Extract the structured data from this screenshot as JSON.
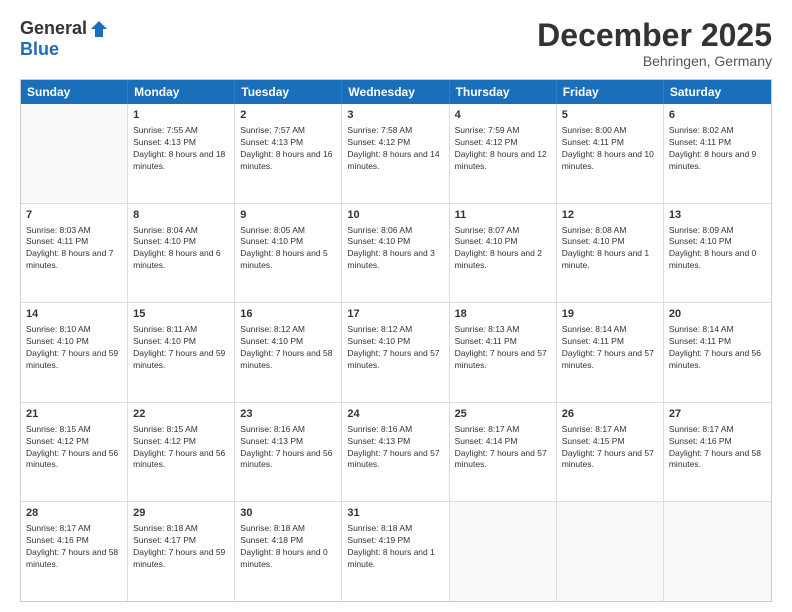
{
  "logo": {
    "general": "General",
    "blue": "Blue"
  },
  "title": "December 2025",
  "subtitle": "Behringen, Germany",
  "header_days": [
    "Sunday",
    "Monday",
    "Tuesday",
    "Wednesday",
    "Thursday",
    "Friday",
    "Saturday"
  ],
  "weeks": [
    [
      {
        "day": "",
        "empty": true
      },
      {
        "day": "1",
        "sunrise": "Sunrise: 7:55 AM",
        "sunset": "Sunset: 4:13 PM",
        "daylight": "Daylight: 8 hours and 18 minutes."
      },
      {
        "day": "2",
        "sunrise": "Sunrise: 7:57 AM",
        "sunset": "Sunset: 4:13 PM",
        "daylight": "Daylight: 8 hours and 16 minutes."
      },
      {
        "day": "3",
        "sunrise": "Sunrise: 7:58 AM",
        "sunset": "Sunset: 4:12 PM",
        "daylight": "Daylight: 8 hours and 14 minutes."
      },
      {
        "day": "4",
        "sunrise": "Sunrise: 7:59 AM",
        "sunset": "Sunset: 4:12 PM",
        "daylight": "Daylight: 8 hours and 12 minutes."
      },
      {
        "day": "5",
        "sunrise": "Sunrise: 8:00 AM",
        "sunset": "Sunset: 4:11 PM",
        "daylight": "Daylight: 8 hours and 10 minutes."
      },
      {
        "day": "6",
        "sunrise": "Sunrise: 8:02 AM",
        "sunset": "Sunset: 4:11 PM",
        "daylight": "Daylight: 8 hours and 9 minutes."
      }
    ],
    [
      {
        "day": "7",
        "sunrise": "Sunrise: 8:03 AM",
        "sunset": "Sunset: 4:11 PM",
        "daylight": "Daylight: 8 hours and 7 minutes."
      },
      {
        "day": "8",
        "sunrise": "Sunrise: 8:04 AM",
        "sunset": "Sunset: 4:10 PM",
        "daylight": "Daylight: 8 hours and 6 minutes."
      },
      {
        "day": "9",
        "sunrise": "Sunrise: 8:05 AM",
        "sunset": "Sunset: 4:10 PM",
        "daylight": "Daylight: 8 hours and 5 minutes."
      },
      {
        "day": "10",
        "sunrise": "Sunrise: 8:06 AM",
        "sunset": "Sunset: 4:10 PM",
        "daylight": "Daylight: 8 hours and 3 minutes."
      },
      {
        "day": "11",
        "sunrise": "Sunrise: 8:07 AM",
        "sunset": "Sunset: 4:10 PM",
        "daylight": "Daylight: 8 hours and 2 minutes."
      },
      {
        "day": "12",
        "sunrise": "Sunrise: 8:08 AM",
        "sunset": "Sunset: 4:10 PM",
        "daylight": "Daylight: 8 hours and 1 minute."
      },
      {
        "day": "13",
        "sunrise": "Sunrise: 8:09 AM",
        "sunset": "Sunset: 4:10 PM",
        "daylight": "Daylight: 8 hours and 0 minutes."
      }
    ],
    [
      {
        "day": "14",
        "sunrise": "Sunrise: 8:10 AM",
        "sunset": "Sunset: 4:10 PM",
        "daylight": "Daylight: 7 hours and 59 minutes."
      },
      {
        "day": "15",
        "sunrise": "Sunrise: 8:11 AM",
        "sunset": "Sunset: 4:10 PM",
        "daylight": "Daylight: 7 hours and 59 minutes."
      },
      {
        "day": "16",
        "sunrise": "Sunrise: 8:12 AM",
        "sunset": "Sunset: 4:10 PM",
        "daylight": "Daylight: 7 hours and 58 minutes."
      },
      {
        "day": "17",
        "sunrise": "Sunrise: 8:12 AM",
        "sunset": "Sunset: 4:10 PM",
        "daylight": "Daylight: 7 hours and 57 minutes."
      },
      {
        "day": "18",
        "sunrise": "Sunrise: 8:13 AM",
        "sunset": "Sunset: 4:11 PM",
        "daylight": "Daylight: 7 hours and 57 minutes."
      },
      {
        "day": "19",
        "sunrise": "Sunrise: 8:14 AM",
        "sunset": "Sunset: 4:11 PM",
        "daylight": "Daylight: 7 hours and 57 minutes."
      },
      {
        "day": "20",
        "sunrise": "Sunrise: 8:14 AM",
        "sunset": "Sunset: 4:11 PM",
        "daylight": "Daylight: 7 hours and 56 minutes."
      }
    ],
    [
      {
        "day": "21",
        "sunrise": "Sunrise: 8:15 AM",
        "sunset": "Sunset: 4:12 PM",
        "daylight": "Daylight: 7 hours and 56 minutes."
      },
      {
        "day": "22",
        "sunrise": "Sunrise: 8:15 AM",
        "sunset": "Sunset: 4:12 PM",
        "daylight": "Daylight: 7 hours and 56 minutes."
      },
      {
        "day": "23",
        "sunrise": "Sunrise: 8:16 AM",
        "sunset": "Sunset: 4:13 PM",
        "daylight": "Daylight: 7 hours and 56 minutes."
      },
      {
        "day": "24",
        "sunrise": "Sunrise: 8:16 AM",
        "sunset": "Sunset: 4:13 PM",
        "daylight": "Daylight: 7 hours and 57 minutes."
      },
      {
        "day": "25",
        "sunrise": "Sunrise: 8:17 AM",
        "sunset": "Sunset: 4:14 PM",
        "daylight": "Daylight: 7 hours and 57 minutes."
      },
      {
        "day": "26",
        "sunrise": "Sunrise: 8:17 AM",
        "sunset": "Sunset: 4:15 PM",
        "daylight": "Daylight: 7 hours and 57 minutes."
      },
      {
        "day": "27",
        "sunrise": "Sunrise: 8:17 AM",
        "sunset": "Sunset: 4:16 PM",
        "daylight": "Daylight: 7 hours and 58 minutes."
      }
    ],
    [
      {
        "day": "28",
        "sunrise": "Sunrise: 8:17 AM",
        "sunset": "Sunset: 4:16 PM",
        "daylight": "Daylight: 7 hours and 58 minutes."
      },
      {
        "day": "29",
        "sunrise": "Sunrise: 8:18 AM",
        "sunset": "Sunset: 4:17 PM",
        "daylight": "Daylight: 7 hours and 59 minutes."
      },
      {
        "day": "30",
        "sunrise": "Sunrise: 8:18 AM",
        "sunset": "Sunset: 4:18 PM",
        "daylight": "Daylight: 8 hours and 0 minutes."
      },
      {
        "day": "31",
        "sunrise": "Sunrise: 8:18 AM",
        "sunset": "Sunset: 4:19 PM",
        "daylight": "Daylight: 8 hours and 1 minute."
      },
      {
        "day": "",
        "empty": true
      },
      {
        "day": "",
        "empty": true
      },
      {
        "day": "",
        "empty": true
      }
    ]
  ]
}
